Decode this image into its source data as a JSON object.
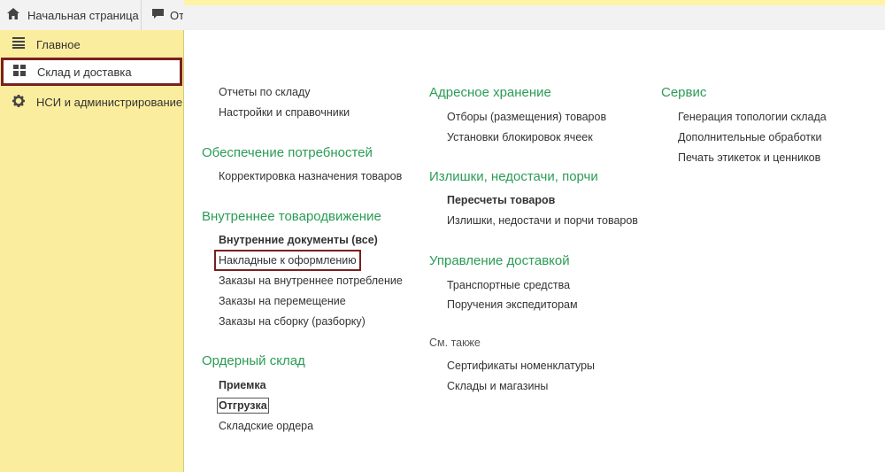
{
  "tabs": {
    "home_label": "Начальная страница",
    "second_label": "От"
  },
  "sidebar": {
    "items": [
      {
        "label": "Главное",
        "icon": "menu-lines-icon"
      },
      {
        "label": "Склад и доставка",
        "icon": "grid-tiles-icon"
      },
      {
        "label": "НСИ и администрирование",
        "icon": "gear-icon"
      }
    ]
  },
  "colors": {
    "sidebar_bg": "#fbed9e",
    "section_title": "#2a9c55",
    "highlight_border": "#7b1f1f"
  },
  "col1": {
    "top_links": [
      "Отчеты по складу",
      "Настройки и справочники"
    ],
    "sections": [
      {
        "title": "Обеспечение потребностей",
        "links": [
          "Корректировка назначения товаров"
        ]
      },
      {
        "title": "Внутреннее товародвижение",
        "links": [
          "Внутренние документы (все)",
          "Накладные к оформлению",
          "Заказы на внутреннее потребление",
          "Заказы на перемещение",
          "Заказы на сборку (разборку)"
        ]
      },
      {
        "title": "Ордерный склад",
        "links": [
          "Приемка",
          "Отгрузка",
          "Складские ордера"
        ]
      }
    ]
  },
  "col2": {
    "sections": [
      {
        "title": "Адресное хранение",
        "links": [
          "Отборы (размещения) товаров",
          "Установки блокировок ячеек"
        ]
      },
      {
        "title": "Излишки, недостачи, порчи",
        "links": [
          "Пересчеты товаров",
          "Излишки, недостачи и порчи товаров"
        ]
      },
      {
        "title": "Управление доставкой",
        "links": [
          "Транспортные средства",
          "Поручения экспедиторам"
        ]
      }
    ],
    "see_also": {
      "title": "См. также",
      "links": [
        "Сертификаты номенклатуры",
        "Склады и магазины"
      ]
    }
  },
  "col3": {
    "sections": [
      {
        "title": "Сервис",
        "links": [
          "Генерация топологии склада",
          "Дополнительные обработки",
          "Печать этикеток и ценников"
        ]
      }
    ]
  }
}
